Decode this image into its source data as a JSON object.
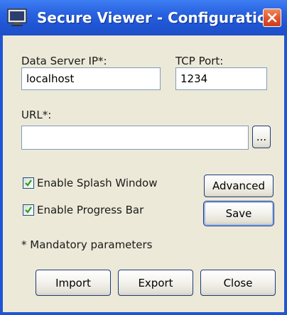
{
  "window": {
    "title": "Secure Viewer - Configuration",
    "app_icon": "monitor-icon",
    "close_icon": "close-icon",
    "colors": {
      "titlebar": "#2a64e2",
      "close_button": "#e2522c",
      "dialog_bg": "#ece9d8",
      "checkmark": "#21a121"
    }
  },
  "form": {
    "server_ip": {
      "label": "Data Server IP*:",
      "value": "localhost"
    },
    "tcp_port": {
      "label": "TCP Port:",
      "value": "1234"
    },
    "url": {
      "label": "URL*:",
      "value": "",
      "browse_label": "..."
    },
    "enable_splash": {
      "label": "Enable Splash Window",
      "checked": true
    },
    "enable_progress": {
      "label": "Enable Progress Bar",
      "checked": true
    },
    "mandatory_note": "* Mandatory parameters"
  },
  "buttons": {
    "advanced": "Advanced",
    "save": "Save",
    "import": "Import",
    "export": "Export",
    "close": "Close"
  }
}
